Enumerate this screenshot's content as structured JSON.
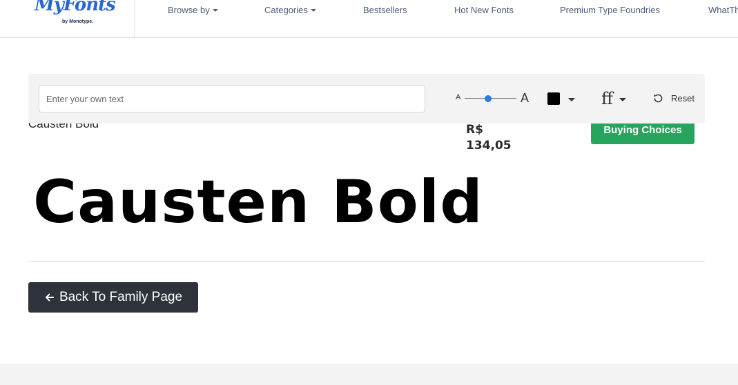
{
  "header": {
    "logo_text": "MyFonts",
    "logo_sub": "by Monotype.",
    "nav": [
      {
        "label": "Browse by",
        "dropdown": true
      },
      {
        "label": "Categories",
        "dropdown": true
      },
      {
        "label": "Bestsellers",
        "dropdown": false
      },
      {
        "label": "Hot New Fonts",
        "dropdown": false
      },
      {
        "label": "Premium Type Foundries",
        "dropdown": false
      },
      {
        "label": "WhatTh",
        "dropdown": false
      }
    ]
  },
  "tester": {
    "placeholder": "Enter your own text",
    "size_small_label": "A",
    "size_large_label": "A",
    "size_level": 0.45,
    "color": "#000000",
    "features_icon": "ff",
    "reset_label": "Reset"
  },
  "product": {
    "name": "Causten Bold",
    "price_currency": "R$",
    "price_value": "134,05",
    "buy_label": "Buying Choices",
    "preview_text": "Causten Bold"
  },
  "back": {
    "label": "Back To Family Page"
  },
  "colors": {
    "brand": "#2a67c9",
    "buy": "#27a55f",
    "back": "#2e323b",
    "slider": "#2a7de1"
  }
}
